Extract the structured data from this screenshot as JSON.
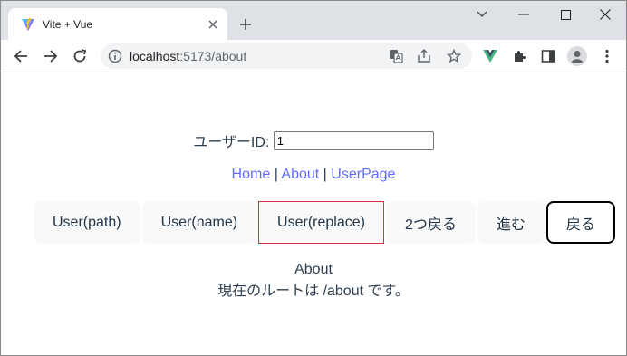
{
  "browser": {
    "tab_title": "Vite + Vue",
    "url_host": "localhost",
    "url_path": ":5173/about",
    "accent": "#646cff"
  },
  "page": {
    "user_label": "ユーザーID:",
    "user_value": "1",
    "nav": {
      "home": "Home",
      "sep1": "|",
      "about": "About",
      "sep2": "|",
      "user_page": "UserPage"
    },
    "buttons": {
      "user_path": "User(path)",
      "user_name": "User(name)",
      "user_replace": "User(replace)",
      "back_two": "2つ戻る",
      "forward": "進む",
      "back": "戻る"
    },
    "view_title": "About",
    "route_text": "現在のルートは /about です。"
  }
}
